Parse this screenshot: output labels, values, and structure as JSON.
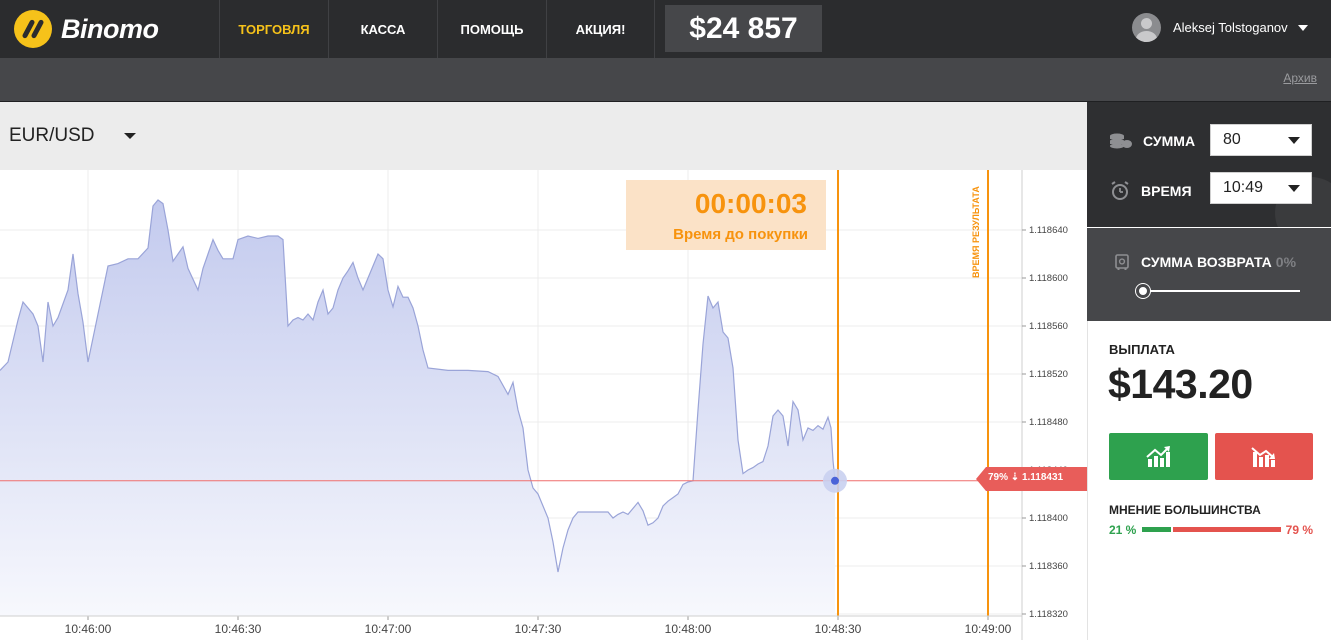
{
  "brand": {
    "name": "Binomo"
  },
  "nav": {
    "items": [
      {
        "label": "ТОРГОВЛЯ",
        "active": true
      },
      {
        "label": "КАССА",
        "active": false
      },
      {
        "label": "ПОМОЩЬ",
        "active": false
      },
      {
        "label": "АКЦИЯ!",
        "active": false
      }
    ],
    "balance": "$24 857"
  },
  "user": {
    "name": "Aleksej Tolstoganov"
  },
  "subbar": {
    "archive_link": "Архив"
  },
  "asset": {
    "pair": "EUR/USD"
  },
  "timer": {
    "value": "00:00:03",
    "label": "Время до покупки"
  },
  "chart": {
    "result_time_label": "ВРЕМЯ РЕЗУЛЬТАТА",
    "current_price_tag": "79% ⇣  1.118431",
    "hidden_tick": "1.118440",
    "colors": {
      "line": "#9aa4d8",
      "fill": "#c9d0ef",
      "price_line": "#ef6f6d",
      "deadline": "#f7930e"
    }
  },
  "chart_data": {
    "type": "area",
    "title": "",
    "xlabel": "",
    "ylabel": "",
    "x_ticks": [
      "10:46:00",
      "10:46:30",
      "10:47:00",
      "10:47:30",
      "10:48:00",
      "10:48:30",
      "10:49:00"
    ],
    "y_ticks": [
      "1.118640",
      "1.118600",
      "1.118560",
      "1.118520",
      "1.118480",
      "1.118400",
      "1.118360",
      "1.118320"
    ],
    "ylim": [
      1.11831,
      1.11868
    ],
    "grid": true,
    "current_price": 1.118431,
    "purchase_deadline": "10:48:30",
    "result_time": "10:49:00",
    "series": [
      {
        "values": [
          [
            "10:45:42",
            1.118523
          ],
          [
            "10:45:44",
            1.11853
          ],
          [
            "10:45:46",
            1.118565
          ],
          [
            "10:45:47",
            1.11858
          ],
          [
            "10:45:49",
            1.11857
          ],
          [
            "10:45:50",
            1.11856
          ],
          [
            "10:45:51",
            1.11853
          ],
          [
            "10:45:52",
            1.11858
          ],
          [
            "10:45:53",
            1.11856
          ],
          [
            "10:45:54",
            1.118567
          ],
          [
            "10:45:56",
            1.11859
          ],
          [
            "10:45:57",
            1.11862
          ],
          [
            "10:45:58",
            1.118587
          ],
          [
            "10:45:59",
            1.118563
          ],
          [
            "10:46:00",
            1.11853
          ],
          [
            "10:46:02",
            1.11857
          ],
          [
            "10:46:04",
            1.11861
          ],
          [
            "10:46:06",
            1.118612
          ],
          [
            "10:46:08",
            1.118616
          ],
          [
            "10:46:10",
            1.118616
          ],
          [
            "10:46:12",
            1.118625
          ],
          [
            "10:46:13",
            1.11866
          ],
          [
            "10:46:14",
            1.118665
          ],
          [
            "10:46:15",
            1.118662
          ],
          [
            "10:46:16",
            1.11864
          ],
          [
            "10:46:17",
            1.118614
          ],
          [
            "10:46:18",
            1.11862
          ],
          [
            "10:46:19",
            1.118626
          ],
          [
            "10:46:20",
            1.118608
          ],
          [
            "10:46:22",
            1.11859
          ],
          [
            "10:46:23",
            1.118608
          ],
          [
            "10:46:24",
            1.11862
          ],
          [
            "10:46:25",
            1.118632
          ],
          [
            "10:46:26",
            1.118623
          ],
          [
            "10:46:27",
            1.118616
          ],
          [
            "10:46:29",
            1.118616
          ],
          [
            "10:46:30",
            1.118632
          ],
          [
            "10:46:32",
            1.118635
          ],
          [
            "10:46:34",
            1.118633
          ],
          [
            "10:46:36",
            1.118635
          ],
          [
            "10:46:38",
            1.118635
          ],
          [
            "10:46:39",
            1.118632
          ],
          [
            "10:46:40",
            1.11856
          ],
          [
            "10:46:41",
            1.118565
          ],
          [
            "10:46:42",
            1.118567
          ],
          [
            "10:46:43",
            1.118565
          ],
          [
            "10:46:44",
            1.11857
          ],
          [
            "10:46:45",
            1.118565
          ],
          [
            "10:46:46",
            1.11858
          ],
          [
            "10:46:47",
            1.11859
          ],
          [
            "10:46:48",
            1.11857
          ],
          [
            "10:46:49",
            1.118575
          ],
          [
            "10:46:50",
            1.11859
          ],
          [
            "10:46:51",
            1.1186
          ],
          [
            "10:46:52",
            1.118606
          ],
          [
            "10:46:53",
            1.118613
          ],
          [
            "10:46:54",
            1.1186
          ],
          [
            "10:46:55",
            1.11859
          ],
          [
            "10:46:56",
            1.1186
          ],
          [
            "10:46:57",
            1.11861
          ],
          [
            "10:46:58",
            1.11862
          ],
          [
            "10:46:59",
            1.118616
          ],
          [
            "10:47:00",
            1.11859
          ],
          [
            "10:47:01",
            1.118576
          ],
          [
            "10:47:02",
            1.118593
          ],
          [
            "10:47:03",
            1.118584
          ],
          [
            "10:47:04",
            1.118584
          ],
          [
            "10:47:05",
            1.118575
          ],
          [
            "10:47:06",
            1.11856
          ],
          [
            "10:47:07",
            1.11854
          ],
          [
            "10:47:08",
            1.118525
          ],
          [
            "10:47:12",
            1.118523
          ],
          [
            "10:47:16",
            1.118523
          ],
          [
            "10:47:20",
            1.118522
          ],
          [
            "10:47:22",
            1.118518
          ],
          [
            "10:47:24",
            1.118503
          ],
          [
            "10:47:25",
            1.118513
          ],
          [
            "10:47:26",
            1.11849
          ],
          [
            "10:47:27",
            1.118475
          ],
          [
            "10:47:28",
            1.11844
          ],
          [
            "10:47:29",
            1.118425
          ],
          [
            "10:47:30",
            1.11842
          ],
          [
            "10:47:32",
            1.1184
          ],
          [
            "10:47:33",
            1.11838
          ],
          [
            "10:47:34",
            1.118355
          ],
          [
            "10:47:35",
            1.118375
          ],
          [
            "10:47:36",
            1.11839
          ],
          [
            "10:47:37",
            1.1184
          ],
          [
            "10:47:38",
            1.118405
          ],
          [
            "10:47:40",
            1.118405
          ],
          [
            "10:47:42",
            1.118405
          ],
          [
            "10:47:44",
            1.118405
          ],
          [
            "10:47:45",
            1.1184
          ],
          [
            "10:47:46",
            1.118403
          ],
          [
            "10:47:47",
            1.118405
          ],
          [
            "10:47:48",
            1.118403
          ],
          [
            "10:47:50",
            1.118413
          ],
          [
            "10:47:51",
            1.118406
          ],
          [
            "10:47:52",
            1.118394
          ],
          [
            "10:47:53",
            1.118396
          ],
          [
            "10:47:54",
            1.1184
          ],
          [
            "10:47:55",
            1.11841
          ],
          [
            "10:47:56",
            1.118414
          ],
          [
            "10:47:57",
            1.118417
          ],
          [
            "10:47:58",
            1.11842
          ],
          [
            "10:47:59",
            1.118428
          ],
          [
            "10:48:00",
            1.11843
          ],
          [
            "10:48:01",
            1.118431
          ],
          [
            "10:48:02",
            1.11849
          ],
          [
            "10:48:03",
            1.118545
          ],
          [
            "10:48:04",
            1.118585
          ],
          [
            "10:48:05",
            1.118575
          ],
          [
            "10:48:06",
            1.11858
          ],
          [
            "10:48:07",
            1.118555
          ],
          [
            "10:48:08",
            1.11855
          ],
          [
            "10:48:09",
            1.118525
          ],
          [
            "10:48:10",
            1.118465
          ],
          [
            "10:48:11",
            1.118437
          ],
          [
            "10:48:12",
            1.11844
          ],
          [
            "10:48:13",
            1.118442
          ],
          [
            "10:48:14",
            1.118445
          ],
          [
            "10:48:15",
            1.118447
          ],
          [
            "10:48:16",
            1.11846
          ],
          [
            "10:48:17",
            1.118485
          ],
          [
            "10:48:18",
            1.11849
          ],
          [
            "10:48:19",
            1.118485
          ],
          [
            "10:48:20",
            1.11846
          ],
          [
            "10:48:21",
            1.118497
          ],
          [
            "10:48:22",
            1.11849
          ],
          [
            "10:48:23",
            1.118465
          ],
          [
            "10:48:24",
            1.118475
          ],
          [
            "10:48:25",
            1.118473
          ],
          [
            "10:48:26",
            1.118477
          ],
          [
            "10:48:27",
            1.118474
          ],
          [
            "10:48:28",
            1.118484
          ],
          [
            "10:48:28.6",
            1.118475
          ],
          [
            "10:48:29",
            1.118448
          ],
          [
            "10:48:29.4",
            1.118431
          ]
        ]
      }
    ]
  },
  "panel": {
    "amount_label": "СУММА",
    "amount_value": "80",
    "time_label": "ВРЕМЯ",
    "time_value": "10:49",
    "refund_label": "СУММА ВОЗВРАТА",
    "refund_pct": "0%",
    "refund_level": 0,
    "payout_label": "ВЫПЛАТА",
    "payout_value": "$143.20",
    "majority_label": "МНЕНИЕ БОЛЬШИНСТВА",
    "majority_up": "21 %",
    "majority_down": "79 %",
    "majority_up_share": 0.21,
    "colors": {
      "up": "#2ea14e",
      "down": "#e4534e",
      "accent": "#f6c21a"
    }
  }
}
